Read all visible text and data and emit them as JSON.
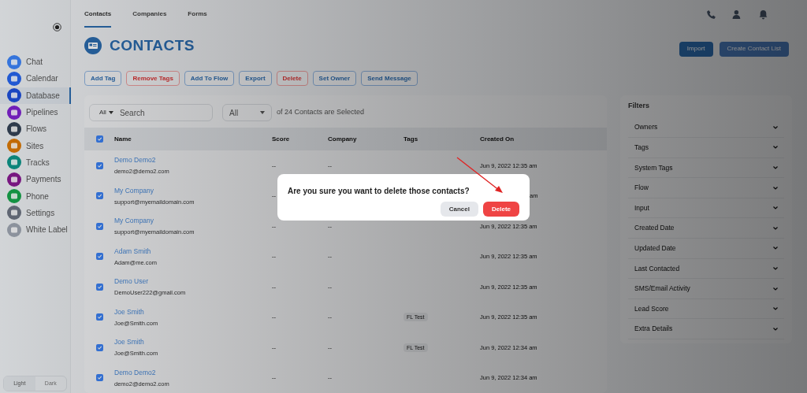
{
  "sidebar": {
    "items": [
      {
        "label": "Chat",
        "selected": false
      },
      {
        "label": "Calendar",
        "selected": false
      },
      {
        "label": "Database",
        "selected": true
      },
      {
        "label": "Pipelines",
        "selected": false
      },
      {
        "label": "Flows",
        "selected": false
      },
      {
        "label": "Sites",
        "selected": false
      },
      {
        "label": "Tracks",
        "selected": false
      },
      {
        "label": "Payments",
        "selected": false
      },
      {
        "label": "Phone",
        "selected": false
      },
      {
        "label": "Settings",
        "selected": false
      },
      {
        "label": "White Label",
        "selected": false
      }
    ],
    "theme": [
      {
        "label": "Light",
        "selected": true
      },
      {
        "label": "Dark",
        "selected": false
      }
    ]
  },
  "tabs": [
    {
      "label": "Contacts",
      "selected": true
    },
    {
      "label": "Companies",
      "selected": false
    },
    {
      "label": "Forms",
      "selected": false
    }
  ],
  "title": "CONTACTS",
  "header_buttons": [
    "Import",
    "Create Contact List"
  ],
  "actions": [
    {
      "label": "Add Tag",
      "kind": "normal"
    },
    {
      "label": "Remove Tags",
      "kind": "danger"
    },
    {
      "label": "Add To Flow",
      "kind": "normal"
    },
    {
      "label": "Export",
      "kind": "normal"
    },
    {
      "label": "Delete",
      "kind": "danger"
    },
    {
      "label": "Set Owner",
      "kind": "normal"
    },
    {
      "label": "Send Message",
      "kind": "normal"
    }
  ],
  "search": {
    "scope": "All",
    "placeholder": "Search"
  },
  "selection": {
    "value": "All",
    "text": "of 24 Contacts are Selected"
  },
  "table": {
    "all_checked": true,
    "columns": [
      "Name",
      "Score",
      "Company",
      "Tags",
      "Created On"
    ],
    "rows": [
      {
        "checked": true,
        "name": "Demo Demo2",
        "email": "demo2@demo2.com",
        "score": "--",
        "company": "--",
        "created": "Jun 9, 2022 12:35 am"
      },
      {
        "checked": true,
        "name": "My Company",
        "email": "support@myemaildomain.com",
        "score": "--",
        "created": "am"
      },
      {
        "checked": true,
        "name": "My Company",
        "email": "support@myemaildomain.com",
        "score": "--",
        "company": "--",
        "created": "Jun 9, 2022 12:35 am"
      },
      {
        "checked": true,
        "name": "Adam Smith",
        "email": "Adam@me.com",
        "score": "--",
        "company": "--",
        "created": "Jun 9, 2022 12:35 am"
      },
      {
        "checked": true,
        "name": "Demo User",
        "email": "DemoUser222@gmail.com",
        "score": "--",
        "company": "--",
        "created": "Jun 9, 2022 12:35 am"
      },
      {
        "checked": true,
        "name": "Joe Smith",
        "email": "Joe@Smith.com",
        "score": "--",
        "company": "--",
        "tag": "FL Test",
        "created": "Jun 9, 2022 12:35 am"
      },
      {
        "checked": true,
        "name": "Joe Smith",
        "email": "Joe@Smith.com",
        "score": "--",
        "company": "--",
        "tag": "FL Test",
        "created": "Jun 9, 2022 12:34 am"
      },
      {
        "checked": true,
        "name": "Demo Demo2",
        "email": "demo2@demo2.com",
        "score": "--",
        "company": "--",
        "created": "Jun 9, 2022 12:34 am"
      }
    ]
  },
  "filters": {
    "title": "Filters",
    "items": [
      "Owners",
      "Tags",
      "System Tags",
      "Flow",
      "Input",
      "Created Date",
      "Updated Date",
      "Last Contacted",
      "SMS/Email Activity",
      "Lead Score",
      "Extra Details"
    ]
  },
  "dialog": {
    "message": "Are you sure you want to delete those contacts?",
    "cancel": "Cancel",
    "confirm": "Delete"
  }
}
